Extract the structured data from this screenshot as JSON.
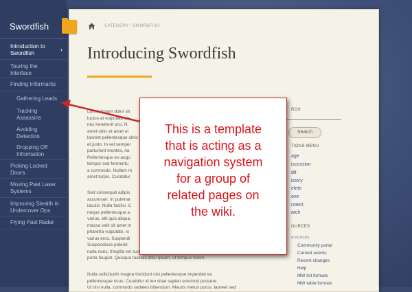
{
  "sidebar": {
    "brand": "Swordfish",
    "items": [
      {
        "label": "Introduction to Swordfish",
        "active": true
      },
      {
        "label": "Touring the Interface"
      },
      {
        "label": "Finding Informants"
      },
      {
        "label": "Gathering Leads"
      },
      {
        "label": "Tracking Assassins"
      },
      {
        "label": "Avoiding Detection"
      },
      {
        "label": "Dropping Off Information"
      },
      {
        "label": "Picking Locked Doors"
      },
      {
        "label": "Moving Past Laser Systems"
      },
      {
        "label": "Improving Stealth in Undercover Ops"
      },
      {
        "label": "Flying Past Radar"
      }
    ],
    "active_chevron": "›"
  },
  "breadcrumb": "CATEGORY / SWORDFISH",
  "page_title": "Introducing Swordfish",
  "body": {
    "p1": "Lorem ipsum dolor sit\nluctus at vulputate ac\nnec hendrerit orci. N\namet odio sit amet el\nlaoreet pellentesque ultric\net justo. In vel semper\nparturient montes, na\nPellentesque eu augu\ntempor sed fermentu\na commodo. Nullam m\namet turpis. Curabitur",
    "p2": "Sed consequat adipis\naccumsan. In pulvinar\niaculis. Nulla facilisi. C\nneque pellentesque a\nvarius, elit quis aliqua\nmassa velit sit amet m\npharetra vulputate, lo\nvarius eros. Suspendi\nSuspendisse potenti. \nnulla nunc, fringilla vel suscipit in, sodales et velit. Vestibulum pretium\nporta feugiat. Quisque facilisis arcu ipsum, ut tempus lorem.",
    "p3": "Nulla sollicitudin magna tincidunt nisi pellentesque imperdiet eu\npellentesque risus. Curabitur id leo vitae sapien euismod posuere.\nUt nisi nulla, commodo sodales bibendum. Mauris metus purus, laoreet sed"
  },
  "right_column": {
    "search_label": "RCH",
    "search_button": "Search",
    "actions_label": "TIONS MENU",
    "actions": [
      "age",
      "iscussion",
      "dit",
      "istory",
      "elete",
      "ove",
      "rotect",
      "atch"
    ],
    "resources_label": "OURCES",
    "resources_heading": "esources",
    "resources": [
      "Community portal",
      "Current events",
      "Recent changes",
      "Help",
      "MW list formats",
      "MW table formats"
    ]
  },
  "callout": {
    "text": "This is a template\nthat is acting as a\nnavigation system\nfor a group of\nrelated pages on\nthe wiki."
  },
  "colors": {
    "accent": "#f0a81c",
    "callout_red": "#d8141a",
    "sidebar_bg": "#2e3d61"
  }
}
